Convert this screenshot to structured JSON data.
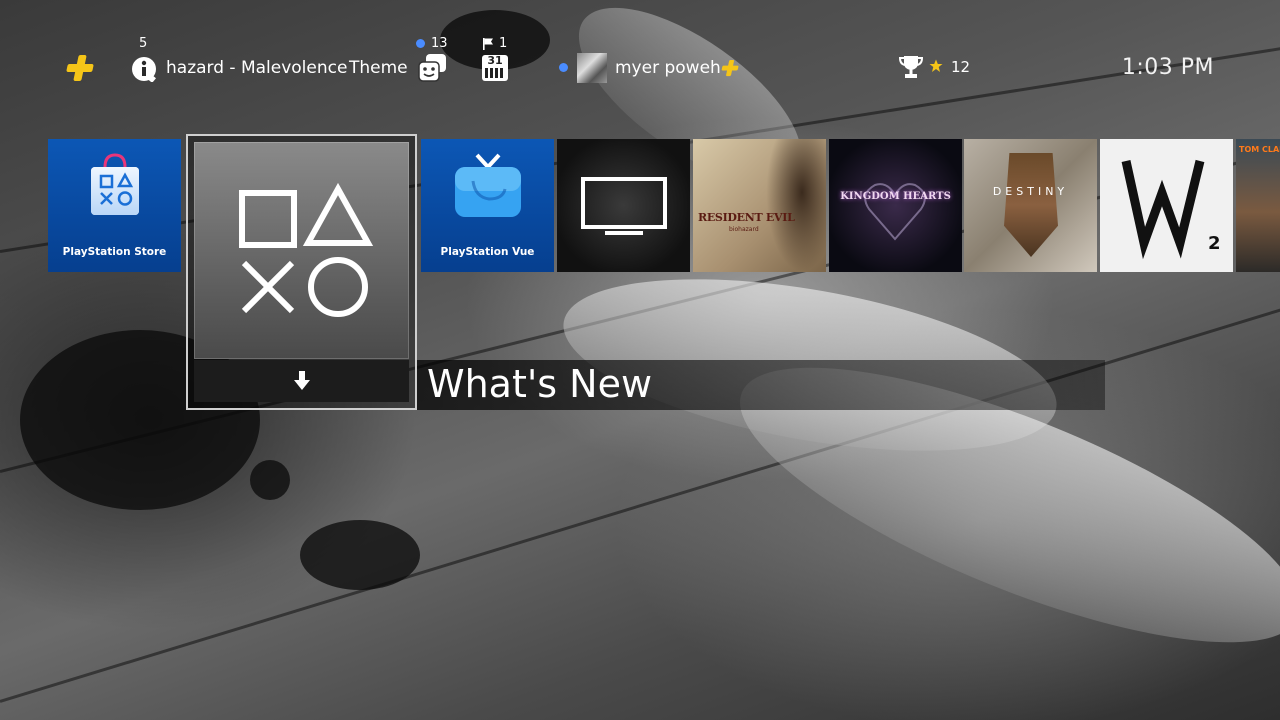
{
  "status_bar": {
    "notifications_count": "5",
    "now_playing_text": "hazard - Malevolence",
    "theme_label": "Theme",
    "friends_count": "13",
    "events_count": "1",
    "calendar_day": "31",
    "username": "myer poweh",
    "trophy_count": "12",
    "clock": "1:03 PM"
  },
  "tiles": {
    "store_label": "PlayStation Store",
    "vue_label": "PlayStation Vue",
    "re7_title": "RESIDENT EVIL",
    "re7_subtitle": "biohazard",
    "kh_title": "KINGDOM HEARTS",
    "destiny_title": "DESTINY",
    "division_text": "TOM CLANCY'S THE D"
  },
  "selected": {
    "label": "What's New"
  },
  "colors": {
    "ps_blue": "#0c57b5",
    "plus_gold": "#f5c518",
    "online_dot": "#4a8cff"
  }
}
